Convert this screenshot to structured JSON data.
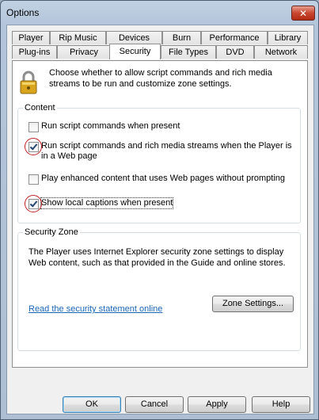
{
  "window": {
    "title": "Options",
    "close_glyph": "✕"
  },
  "tabs_row1": [
    "Player",
    "Rip Music",
    "Devices",
    "Burn",
    "Performance",
    "Library"
  ],
  "tabs_row2": [
    "Plug-ins",
    "Privacy",
    "Security",
    "File Types",
    "DVD",
    "Network"
  ],
  "active_tab": "Security",
  "intro_text": "Choose whether to allow script commands and rich media streams to be run and customize zone settings.",
  "content": {
    "label": "Content",
    "options": [
      {
        "label": "Run script commands when present",
        "checked": false
      },
      {
        "label": "Run script commands and rich media streams when the Player is in a Web page",
        "checked": true
      },
      {
        "label": "Play enhanced content that uses Web pages without prompting",
        "checked": false
      },
      {
        "label": "Show local captions when present",
        "checked": true
      }
    ]
  },
  "security_zone": {
    "label": "Security Zone",
    "text": "The Player uses Internet Explorer security zone settings to display Web content, such as that provided in the Guide and online stores.",
    "link": "Read the security statement online",
    "zone_button": "Zone Settings..."
  },
  "buttons": {
    "ok": "OK",
    "cancel": "Cancel",
    "apply": "Apply",
    "help": "Help"
  },
  "colors": {
    "link": "#1a66b8",
    "annotation_circle": "#c02020",
    "close_button": "#c8462f"
  }
}
